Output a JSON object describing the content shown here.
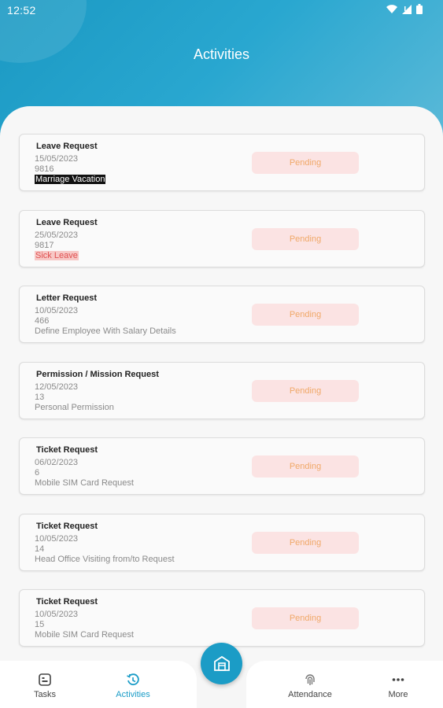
{
  "status_bar": {
    "time": "12:52"
  },
  "header": {
    "title": "Activities"
  },
  "activities": [
    {
      "type": "Leave Request",
      "date": "15/05/2023",
      "id": "9816",
      "description": "Marriage Vacation",
      "status": "Pending"
    },
    {
      "type": "Leave Request",
      "date": "25/05/2023",
      "id": "9817",
      "description": "Sick Leave",
      "status": "Pending"
    },
    {
      "type": "Letter Request",
      "date": "10/05/2023",
      "id": "466",
      "description": "Define Employee With Salary Details",
      "status": "Pending"
    },
    {
      "type": "Permission / Mission Request",
      "date": "12/05/2023",
      "id": "13",
      "description": "Personal Permission",
      "status": "Pending"
    },
    {
      "type": "Ticket Request",
      "date": "06/02/2023",
      "id": "6",
      "description": "Mobile SIM Card Request",
      "status": "Pending"
    },
    {
      "type": "Ticket Request",
      "date": "10/05/2023",
      "id": "14",
      "description": "Head Office Visiting from/to Request",
      "status": "Pending"
    },
    {
      "type": "Ticket Request",
      "date": "10/05/2023",
      "id": "15",
      "description": "Mobile SIM Card Request",
      "status": "Pending"
    }
  ],
  "bottom_nav": {
    "tasks": "Tasks",
    "activities": "Activities",
    "attendance": "Attendance",
    "more": "More"
  },
  "colors": {
    "accent": "#1b9cc6",
    "pending_bg": "#fbe3e3",
    "pending_text": "#f0a868"
  },
  "icons": {
    "tasks": "tasks-icon",
    "activities": "history-icon",
    "fab": "store-icon",
    "attendance": "fingerprint-icon",
    "more": "more-dots-icon"
  }
}
